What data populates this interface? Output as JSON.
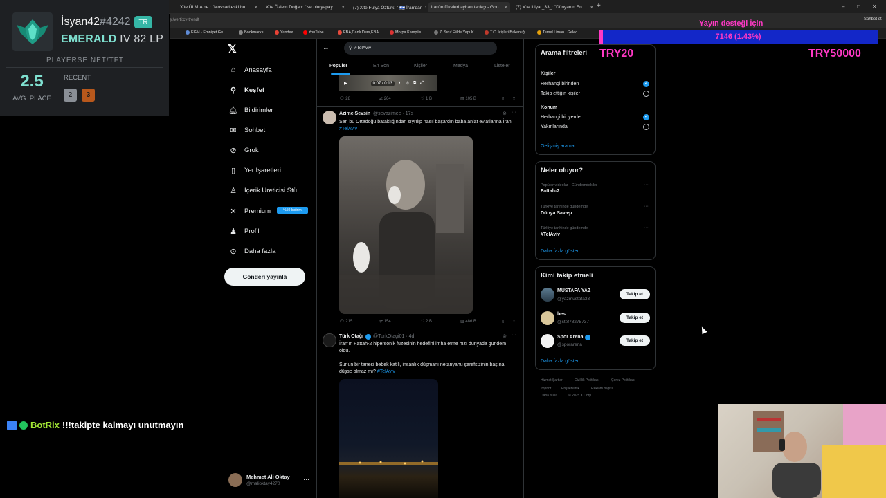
{
  "browser": {
    "tabs": [
      {
        "label": "X'te ÜLMİA ne : \"Mossad eski bu"
      },
      {
        "label": "X'te Özlem Doğan: \"Ne oluryapay"
      },
      {
        "label": "(7) X'te Fulya Öztürk: \" 🇮🇱 İran'dan"
      },
      {
        "label": "iran'ın füzeleri ayhan tarıkçı - Goo"
      },
      {
        "label": "(7) X'te iltiyar_33_: \"Dünyanın En"
      }
    ],
    "url": "ş:/verti:cv-trendt",
    "bookmarks": [
      "EGM - Emniyet Ge...",
      "Bookmarks",
      "Yandex",
      "YouTube",
      "EBA,Canlı Ders,EBA...",
      "Morpa Kampüs",
      "7. Sınıf Fiilde Yapı K...",
      "T.C. İçişleri Bakanlığı",
      "Temel Liman | Gelec..."
    ],
    "profile_label": "Sohbet et"
  },
  "tft": {
    "name": "İsyan42",
    "tag": "#4242",
    "region": "TR",
    "tier": "EMERALD",
    "division": "IV 82 LP",
    "site": "PLAYERSE.NET/TFT",
    "avg_place": "2.5",
    "avg_label": "AVG. PLACE",
    "recent_label": "RECENT",
    "recent": [
      {
        "place": "2",
        "color": "#8a8f96"
      },
      {
        "place": "3",
        "color": "#b8581c"
      }
    ]
  },
  "nav": {
    "items": [
      {
        "label": "Anasayfa",
        "icon": "home-icon"
      },
      {
        "label": "Keşfet",
        "icon": "search-icon"
      },
      {
        "label": "Bildirimler",
        "icon": "bell-icon"
      },
      {
        "label": "Sohbet",
        "icon": "mail-icon"
      },
      {
        "label": "Grok",
        "icon": "grok-icon"
      },
      {
        "label": "Yer İşaretleri",
        "icon": "bookmark-icon"
      },
      {
        "label": "İçerik Üreticisi Stü...",
        "icon": "creator-icon"
      },
      {
        "label": "Premium",
        "icon": "x-icon"
      },
      {
        "label": "Profil",
        "icon": "person-icon"
      },
      {
        "label": "Daha fazla",
        "icon": "more-icon"
      }
    ],
    "premium_badge": "%50 İndirim",
    "post_button": "Gönderi yayınla",
    "user_name": "Mehmet Ali Oktay",
    "user_handle": "@malioktay4270"
  },
  "search": {
    "query": "#TelAviv",
    "tabs": [
      "Popüler",
      "En Son",
      "Kişiler",
      "Medya",
      "Listeler"
    ]
  },
  "video": {
    "time": "0:07 / 0:13"
  },
  "tweets": [
    {
      "stats": {
        "replies": "28",
        "reposts": "264",
        "likes": "1 B",
        "views": "105 B"
      }
    },
    {
      "name": "Azime Sevsin",
      "handle": "@sevazimee · 17s",
      "text": "Sen bu Ortadoğu bataklığından sıyrılıp nasıl başardın baba anlat evlatlarına İran",
      "hashtag": "#TelAviv",
      "stats": {
        "replies": "215",
        "reposts": "154",
        "likes": "2 B",
        "views": "486 B"
      }
    },
    {
      "name": "Türk Otağı",
      "handle": "@TurkOtagi01 · 4d",
      "text": "İran'ın Fattah-2 hipersonik füzesinin hedefini imha etme hızı dünyada gündem oldu.",
      "text2": "Şunun bir tanesi bebek katili, insanlık düşmanı netanyahu şerefsizinin başına düşse olmaz mı?",
      "hashtag": "#TelAviv"
    }
  ],
  "filters": {
    "title": "Arama filtreleri",
    "people_label": "Kişiler",
    "people_options": [
      "Herhangi birinden",
      "Takip ettiğin kişiler"
    ],
    "location_label": "Konum",
    "location_options": [
      "Herhangi bir yerde",
      "Yakınlarında"
    ],
    "advanced": "Gelişmiş arama"
  },
  "trends": {
    "title": "Neler oluyor?",
    "items": [
      {
        "meta": "Popüler videolar · Gündemdekiler",
        "name": "Fattah-2"
      },
      {
        "meta": "Türkiye tarihinde gündemde",
        "name": "Dünya Savaşı"
      },
      {
        "meta": "Türkiye tarihinde gündemde",
        "name": "#TelAviv"
      }
    ],
    "more": "Daha fazla göster"
  },
  "who_to_follow": {
    "title": "Kimi takip etmeli",
    "users": [
      {
        "name": "MUSTAFA YAZ",
        "handle": "@yazmustafa33"
      },
      {
        "name": "bes",
        "handle": "@stef78275737"
      },
      {
        "name": "Spor Arena",
        "handle": "@sporarena"
      }
    ],
    "follow_label": "Takip et",
    "more": "Daha fazla göster"
  },
  "footer": [
    "Hizmet Şartları",
    "Gizlilik Politikası",
    "Çerez Politikası",
    "Imprint",
    "Erişilebilirlik",
    "Reklam bilgisi",
    "Daha fazla",
    "© 2025 X Corp."
  ],
  "stream": {
    "donation_label": "Yayın desteği İçin",
    "donation_value": "7146 (1.43%)",
    "donation_progress": 0.0143,
    "try_left": "TRY20",
    "try_right": "TRY50000",
    "bot_name": "BotRix",
    "bot_message": "!!!takipte kalmayı unutmayın"
  }
}
